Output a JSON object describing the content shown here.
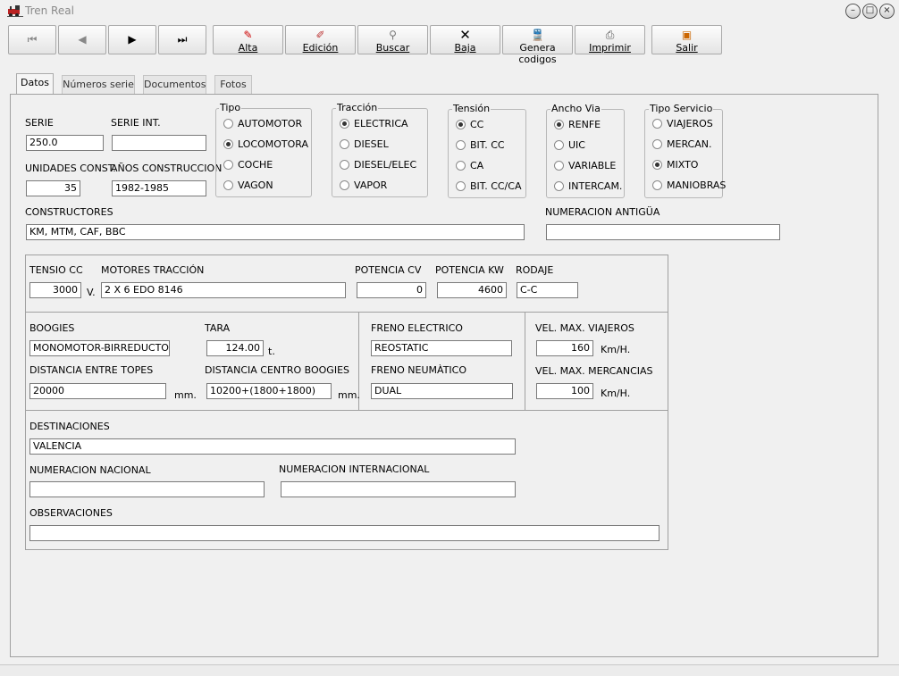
{
  "window": {
    "title": "Tren Real"
  },
  "toolbar": {
    "first_icon": "⏮",
    "prev_icon": "◀",
    "next_icon": "▶",
    "last_icon": "⏭",
    "alta": "Alta",
    "edicion": "Edición",
    "buscar": "Buscar",
    "baja": "Baja",
    "genera": "Genera codigos",
    "imprimir": "Imprimir",
    "salir": "Salir"
  },
  "tabs": [
    "Datos",
    "Números serie",
    "Documentos",
    "Fotos"
  ],
  "form": {
    "serie_label": "SERIE",
    "serie_value": "250.0",
    "serie_int_label": "SERIE INT.",
    "serie_int_value": "",
    "unidades_label": "UNIDADES CONST.",
    "unidades_value": "35",
    "anos_label": "AÑOS CONSTRUCCION",
    "anos_value": "1982-1985",
    "constructores_label": "CONSTRUCTORES",
    "constructores_value": "KM, MTM, CAF, BBC",
    "numeracion_antigua_label": "NUMERACION ANTIGÜA",
    "numeracion_antigua_value": "",
    "tensio_label": "TENSIO CC",
    "tensio_value": "3000",
    "tensio_unit": "V.",
    "motores_label": "MOTORES TRACCIÓN",
    "motores_value": "2 X 6 EDO 8146",
    "potencia_cv_label": "POTENCIA CV",
    "potencia_cv_value": "0",
    "potencia_kw_label": "POTENCIA KW",
    "potencia_kw_value": "4600",
    "rodaje_label": "RODAJE",
    "rodaje_value": "C-C",
    "boogies_label": "BOOGIES",
    "boogies_value": "MONOMOTOR-BIRREDUCTOR",
    "tara_label": "TARA",
    "tara_value": "124.00",
    "tara_unit": "t.",
    "distancia_topes_label": "DISTANCIA ENTRE TOPES",
    "distancia_topes_value": "20000",
    "distancia_topes_unit": "mm.",
    "distancia_boogies_label": "DISTANCIA CENTRO BOOGIES",
    "distancia_boogies_value": "10200+(1800+1800)",
    "distancia_boogies_unit": "mm.",
    "freno_electrico_label": "FRENO ELECTRICO",
    "freno_electrico_value": "REOSTATIC",
    "freno_neumatico_label": "FRENO NEUMÀTICO",
    "freno_neumatico_value": "DUAL",
    "vel_viajeros_label": "VEL. MAX. VIAJEROS",
    "vel_viajeros_value": "160",
    "vel_viajeros_unit": "Km/H.",
    "vel_mercancias_label": "VEL. MAX. MERCANCIAS",
    "vel_mercancias_value": "100",
    "vel_mercancias_unit": "Km/H.",
    "destinaciones_label": "DESTINACIONES",
    "destinaciones_value": "VALENCIA",
    "num_nacional_label": "NUMERACION NACIONAL",
    "num_nacional_value": "",
    "num_internacional_label": "NUMERACION INTERNACIONAL",
    "num_internacional_value": "",
    "observaciones_label": "OBSERVACIONES",
    "observaciones_value": ""
  },
  "groups": {
    "tipo": {
      "title": "Tipo",
      "options": [
        "AUTOMOTOR",
        "LOCOMOTORA",
        "COCHE",
        "VAGON"
      ],
      "selected": "LOCOMOTORA"
    },
    "traccion": {
      "title": "Tracción",
      "options": [
        "ELECTRICA",
        "DIESEL",
        "DIESEL/ELEC",
        "VAPOR"
      ],
      "selected": "ELECTRICA"
    },
    "tension": {
      "title": "Tensión",
      "options": [
        "CC",
        "BIT. CC",
        "CA",
        "BIT. CC/CA"
      ],
      "selected": "CC"
    },
    "ancho": {
      "title": "Ancho Via",
      "options": [
        "RENFE",
        "UIC",
        "VARIABLE",
        "INTERCAM."
      ],
      "selected": "RENFE"
    },
    "servicio": {
      "title": "Tipo Servicio",
      "options": [
        "VIAJEROS",
        "MERCAN.",
        "MIXTO",
        "MANIOBRAS"
      ],
      "selected": "MIXTO"
    }
  }
}
